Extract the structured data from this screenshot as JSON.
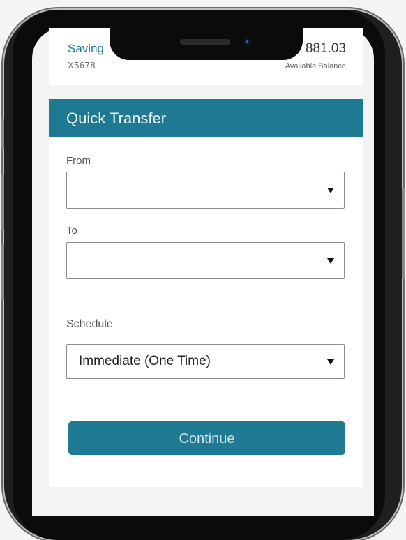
{
  "account": {
    "name": "Saving",
    "number": "X5678",
    "balance": "881.03",
    "balance_label": "Available Balance"
  },
  "quick_transfer": {
    "title": "Quick Transfer",
    "from": {
      "label": "From",
      "value": "",
      "icon": "dropdown-caret-icon"
    },
    "to": {
      "label": "To",
      "value": "",
      "icon": "dropdown-caret-icon"
    },
    "schedule": {
      "label": "Schedule",
      "value": "Immediate (One Time)",
      "icon": "dropdown-caret-icon"
    },
    "continue_label": "Continue"
  },
  "colors": {
    "accent": "#1d7a92",
    "background": "#f1f3f5"
  }
}
